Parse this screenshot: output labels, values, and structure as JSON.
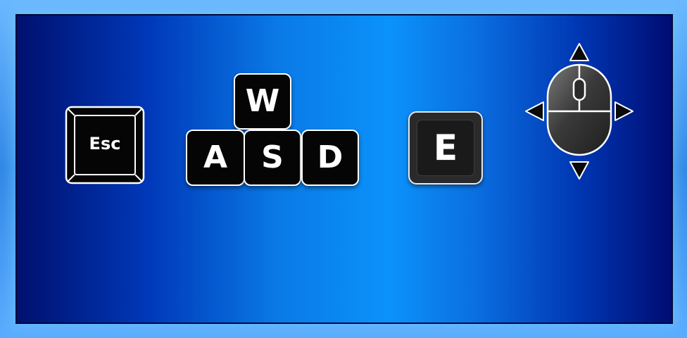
{
  "keys": {
    "esc": "Esc",
    "w": "W",
    "a": "A",
    "s": "S",
    "d": "D",
    "e": "E"
  },
  "icons": {
    "mouse": "mouse-icon",
    "arrows": [
      "arrow-up-icon",
      "arrow-down-icon",
      "arrow-left-icon",
      "arrow-right-icon"
    ]
  },
  "colors": {
    "key_fill": "#050505",
    "key_border": "#ffffff",
    "panel_center": "#0b92fb",
    "panel_edge": "#00106e"
  }
}
